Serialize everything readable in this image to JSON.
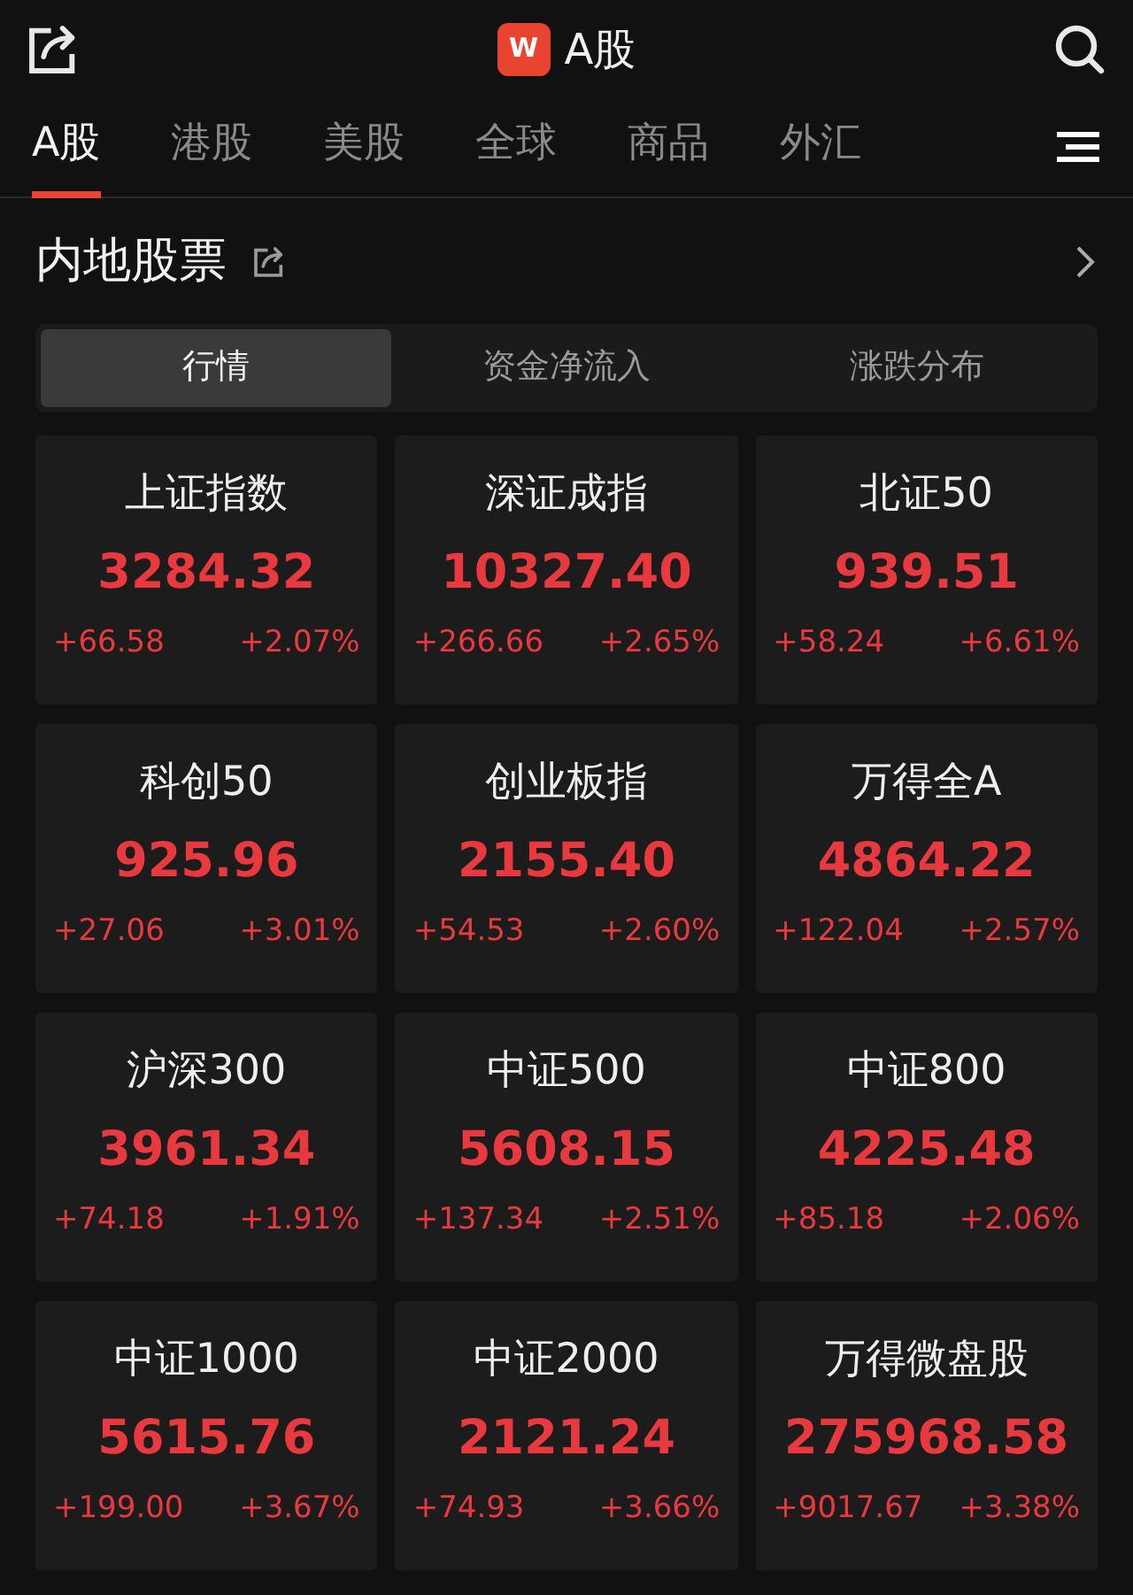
{
  "header": {
    "logo_letter": "W",
    "title": "A股"
  },
  "tabs": [
    {
      "label": "A股",
      "selected": true
    },
    {
      "label": "港股",
      "selected": false
    },
    {
      "label": "美股",
      "selected": false
    },
    {
      "label": "全球",
      "selected": false
    },
    {
      "label": "商品",
      "selected": false
    },
    {
      "label": "外汇",
      "selected": false
    }
  ],
  "section": {
    "title": "内地股票"
  },
  "segments": [
    {
      "label": "行情",
      "selected": true
    },
    {
      "label": "资金净流入",
      "selected": false
    },
    {
      "label": "涨跌分布",
      "selected": false
    }
  ],
  "indices": [
    {
      "name": "上证指数",
      "value": "3284.32",
      "change": "+66.58",
      "percent": "+2.07%"
    },
    {
      "name": "深证成指",
      "value": "10327.40",
      "change": "+266.66",
      "percent": "+2.65%"
    },
    {
      "name": "北证50",
      "value": "939.51",
      "change": "+58.24",
      "percent": "+6.61%"
    },
    {
      "name": "科创50",
      "value": "925.96",
      "change": "+27.06",
      "percent": "+3.01%"
    },
    {
      "name": "创业板指",
      "value": "2155.40",
      "change": "+54.53",
      "percent": "+2.60%"
    },
    {
      "name": "万得全A",
      "value": "4864.22",
      "change": "+122.04",
      "percent": "+2.57%"
    },
    {
      "name": "沪深300",
      "value": "3961.34",
      "change": "+74.18",
      "percent": "+1.91%"
    },
    {
      "name": "中证500",
      "value": "5608.15",
      "change": "+137.34",
      "percent": "+2.51%"
    },
    {
      "name": "中证800",
      "value": "4225.48",
      "change": "+85.18",
      "percent": "+2.06%"
    },
    {
      "name": "中证1000",
      "value": "5615.76",
      "change": "+199.00",
      "percent": "+3.67%"
    },
    {
      "name": "中证2000",
      "value": "2121.24",
      "change": "+74.93",
      "percent": "+3.66%"
    },
    {
      "name": "万得微盘股",
      "value": "275968.58",
      "change": "+9017.67",
      "percent": "+3.38%"
    }
  ]
}
